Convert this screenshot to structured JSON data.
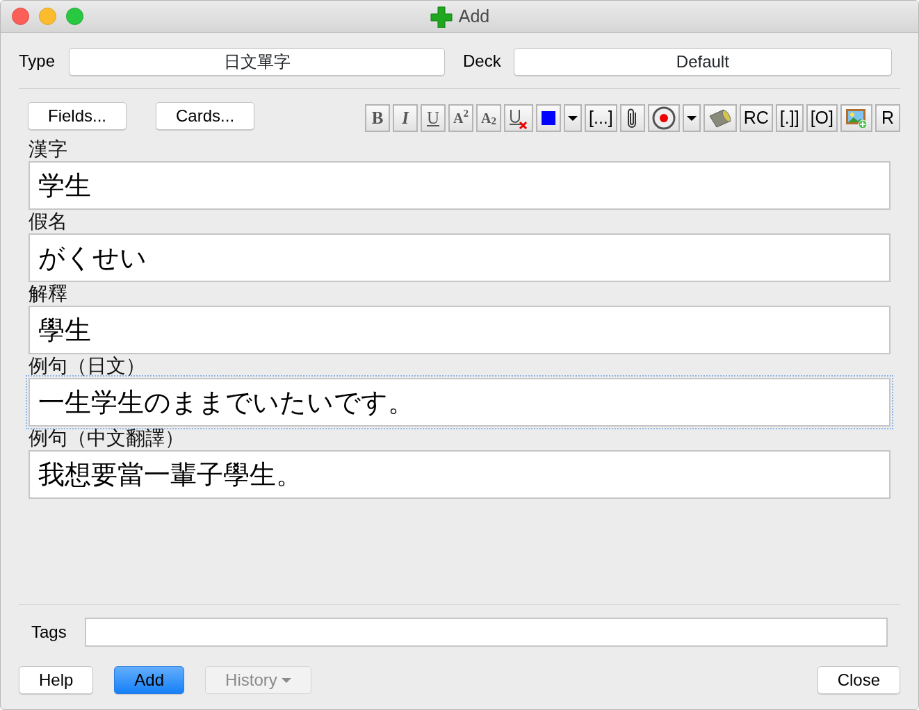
{
  "window": {
    "title": "Add"
  },
  "type": {
    "label": "Type",
    "value": "日文單字"
  },
  "deck": {
    "label": "Deck",
    "value": "Default"
  },
  "top_buttons": [
    "Fields...",
    "Cards..."
  ],
  "toolbar": [
    {
      "kind": "bold",
      "label": "B"
    },
    {
      "kind": "italic",
      "label": "I"
    },
    {
      "kind": "underline",
      "label": "U"
    },
    {
      "kind": "super",
      "label": "A$^{2}$"
    },
    {
      "kind": "sub",
      "label": "A$_{2}$"
    },
    {
      "kind": "clear"
    },
    {
      "kind": "color",
      "color": "#0000ff"
    },
    {
      "kind": "dropdown"
    },
    {
      "kind": "text",
      "label": "[...]"
    },
    {
      "kind": "attach"
    },
    {
      "kind": "record"
    },
    {
      "kind": "dropdown"
    },
    {
      "kind": "audio"
    },
    {
      "kind": "text",
      "label": "RC"
    },
    {
      "kind": "text",
      "label": "[.]]"
    },
    {
      "kind": "text",
      "label": "[O]"
    },
    {
      "kind": "image"
    },
    {
      "kind": "text",
      "label": "R"
    }
  ],
  "fields": [
    {
      "label": "漢字",
      "value": "学生",
      "focused": false
    },
    {
      "label": "假名",
      "value": "がくせい",
      "focused": false
    },
    {
      "label": "解釋",
      "value": "學生",
      "focused": false
    },
    {
      "label": "例句（日文）",
      "value": "一生学生のままでいたいです。",
      "focused": true
    },
    {
      "label": "例句（中文翻譯）",
      "value": "我想要當一輩子學生。",
      "focused": false
    }
  ],
  "tags": {
    "label": "Tags"
  },
  "footer_buttons": [
    {
      "label": "Help",
      "default": false,
      "disabled": false,
      "dropdown": false
    },
    {
      "label": "Add",
      "default": true,
      "disabled": false,
      "dropdown": false
    },
    {
      "label": "History",
      "default": false,
      "disabled": true,
      "dropdown": true
    },
    {
      "label": "Close",
      "default": false,
      "disabled": false,
      "dropdown": false
    }
  ]
}
